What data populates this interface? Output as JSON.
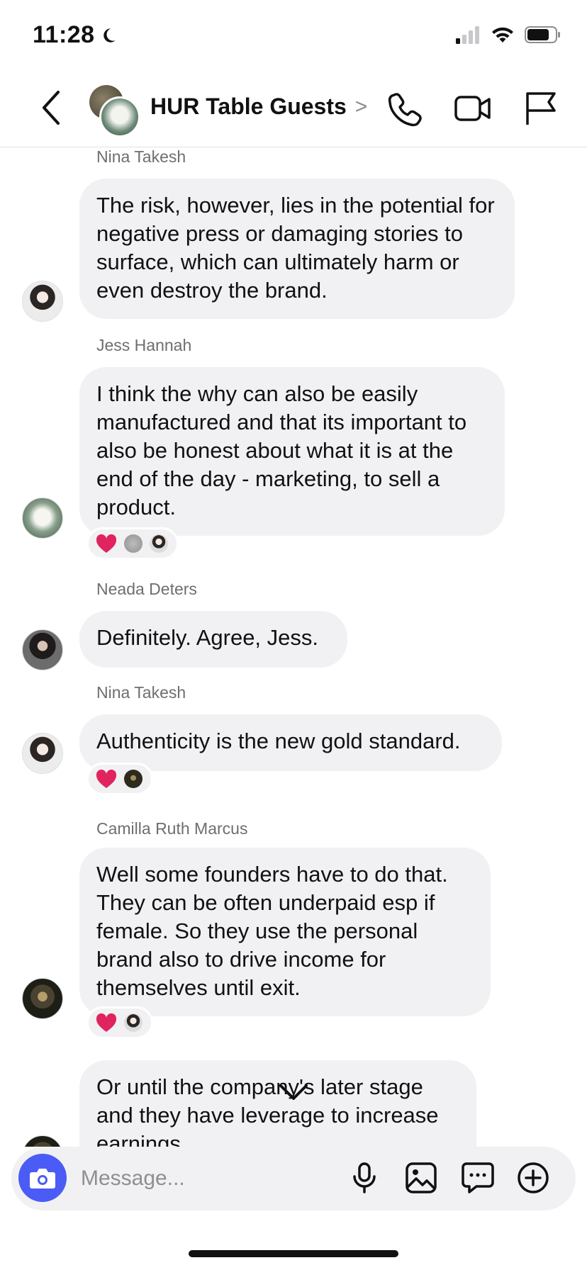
{
  "status_bar": {
    "time": "11:28"
  },
  "header": {
    "title": "HUR Table Guests",
    "title_chevron": ">"
  },
  "messages": [
    {
      "sender": "Nina Takesh",
      "text": "The risk, however, lies in the potential for negative press or damaging stories to surface, which can ultimately harm or even destroy the brand."
    },
    {
      "sender": "Jess Hannah",
      "text": "I think the why can also be easily manufactured and that its important to also be honest about what it is at the end of the day - marketing, to sell a product."
    },
    {
      "sender": "Neada Deters",
      "text": "Definitely. Agree, Jess."
    },
    {
      "sender": "Nina Takesh",
      "text": "Authenticity is the new gold standard."
    },
    {
      "sender": "Camilla Ruth Marcus",
      "text": "Well some founders have to do that. They can be often underpaid esp if female. So they use the personal brand also to drive income for themselves until exit."
    },
    {
      "sender": "",
      "text": "Or until the company's later stage and they have leverage to increase earnings"
    }
  ],
  "composer": {
    "placeholder": "Message..."
  },
  "colors": {
    "accent": "#4a5cf5",
    "bubble": "#f1f1f3",
    "heart": "#e0245e"
  }
}
